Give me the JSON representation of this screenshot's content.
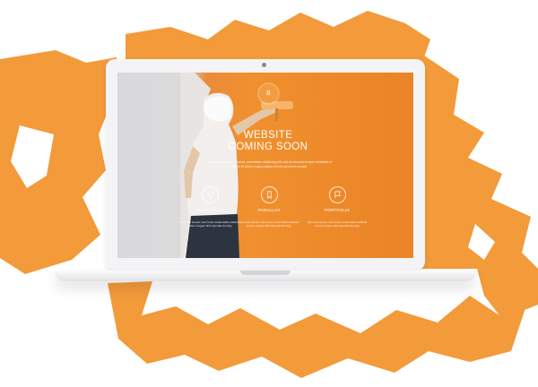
{
  "site": {
    "logo_letter": "B",
    "headline_line1": "WEBSITE",
    "headline_line2": "COMING SOON",
    "intro": "Lorem ipsum dolor sit amet, consectetur adipiscing elit, sed do eiusmod tempor incididunt ut labore et dolore magna aliqua ut enim ad minim veniam."
  },
  "features": [
    {
      "icon": "send-icon",
      "title": "RESPONSIVE",
      "text": "Nam sed tempor nunc lorem solute tellus eleifend cursus congue nihil imperdiet doming."
    },
    {
      "icon": "bookmark-icon",
      "title": "PARALLAX",
      "text": "Nam sed tempor nunc lorem solute tellus eleifend cursus congue nihil imperdiet doming."
    },
    {
      "icon": "flag-icon",
      "title": "PORTFOLIO",
      "text": "Nam sed tempor nunc lorem solute tellus eleifend cursus congue nihil imperdiet doming."
    }
  ],
  "colors": {
    "brush_orange": "#f39a3a",
    "screen_orange": "#ee8a2a",
    "laptop_silver": "#f4f4f6"
  }
}
